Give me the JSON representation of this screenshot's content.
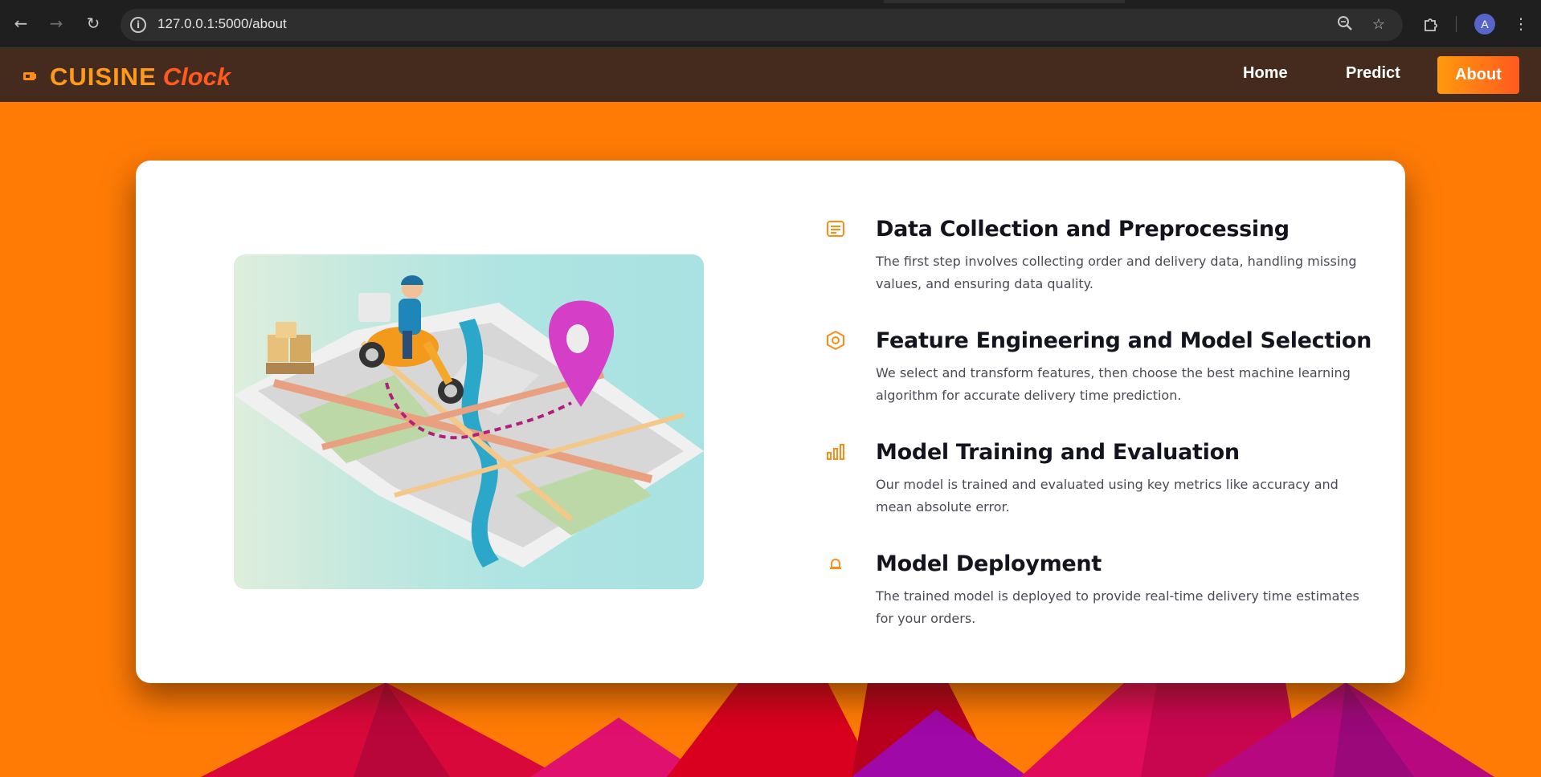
{
  "browser": {
    "url": "127.0.0.1:5000/about",
    "avatar_letter": "A",
    "icons": [
      "back-arrow-icon",
      "forward-arrow-icon",
      "reload-icon",
      "site-info-icon",
      "zoom-icon",
      "bookmark-star-icon",
      "extensions-icon",
      "menu-kebab-icon"
    ]
  },
  "site": {
    "logo_part1": "CUISINE",
    "logo_part2": "Clock",
    "nav": {
      "home": "Home",
      "predict": "Predict",
      "about": "About"
    },
    "colors": {
      "background": "#ff7b05",
      "navbar": "#452b1d",
      "accent": "#ff9a1a",
      "accent_dark": "#ff5a1f"
    }
  },
  "features": [
    {
      "icon": "document-list-icon",
      "title": "Data Collection and Preprocessing",
      "desc": "The first step involves collecting order and delivery data, handling missing values, and ensuring data quality."
    },
    {
      "icon": "hexagon-cog-icon",
      "title": "Feature Engineering and Model Selection",
      "desc": "We select and transform features, then choose the best machine learning algorithm for accurate delivery time prediction."
    },
    {
      "icon": "bar-chart-icon",
      "title": "Model Training and Evaluation",
      "desc": "Our model is trained and evaluated using key metrics like accuracy and mean absolute error."
    },
    {
      "icon": "deploy-bell-icon",
      "title": "Model Deployment",
      "desc": "The trained model is deployed to provide real-time delivery time estimates for your orders."
    }
  ]
}
